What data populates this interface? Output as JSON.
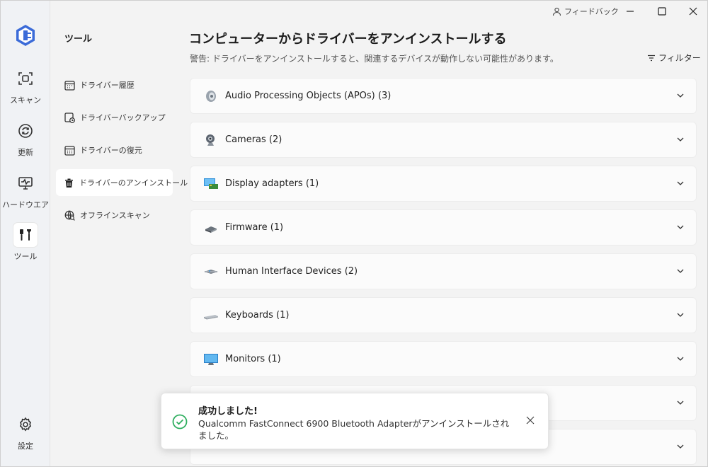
{
  "window": {
    "feedback_label": "フィードバック",
    "icons": {
      "minimize": "minimize-icon",
      "maximize": "maximize-icon",
      "close": "close-icon"
    }
  },
  "rail": {
    "accent": "#3b6bd8",
    "items": [
      {
        "label": "スキャン",
        "icon": "scan-icon"
      },
      {
        "label": "更新",
        "icon": "refresh-icon"
      },
      {
        "label": "ハードウエア",
        "icon": "monitor-pulse-icon"
      },
      {
        "label": "ツール",
        "icon": "tools-icon",
        "active": true
      },
      {
        "label": "設定",
        "icon": "gear-icon"
      }
    ]
  },
  "subnav": {
    "title": "ツール",
    "items": [
      {
        "label": "ドライバー履歴",
        "icon": "calendar-icon"
      },
      {
        "label": "ドライバーバックアップ",
        "icon": "backup-icon"
      },
      {
        "label": "ドライバーの復元",
        "icon": "restore-icon"
      },
      {
        "label": "ドライバーのアンインストール",
        "icon": "trash-icon",
        "active": true
      },
      {
        "label": "オフラインスキャン",
        "icon": "globe-search-icon"
      }
    ]
  },
  "main": {
    "title": "コンピューターからドライバーをアンインストールする",
    "warning": "警告: ドライバーをアンインストールすると、関連するデバイスが動作しない可能性があります。",
    "filter_label": "フィルター",
    "devices": [
      {
        "label": "Audio Processing Objects (APOs) (3)",
        "icon": "speaker-icon"
      },
      {
        "label": "Cameras (2)",
        "icon": "webcam-icon"
      },
      {
        "label": "Display adapters (1)",
        "icon": "display-adapter-icon"
      },
      {
        "label": "Firmware (1)",
        "icon": "chip-icon"
      },
      {
        "label": "Human Interface Devices (2)",
        "icon": "hid-icon"
      },
      {
        "label": "Keyboards (1)",
        "icon": "keyboard-icon"
      },
      {
        "label": "Monitors (1)",
        "icon": "monitor-icon"
      },
      {
        "label": "",
        "icon": "device-icon"
      },
      {
        "label": "",
        "icon": "device-icon"
      }
    ]
  },
  "toast": {
    "title": "成功しました!",
    "message": "Qualcomm FastConnect 6900 Bluetooth Adapterがアンインストールされました。",
    "success_color": "#2fae5f"
  }
}
